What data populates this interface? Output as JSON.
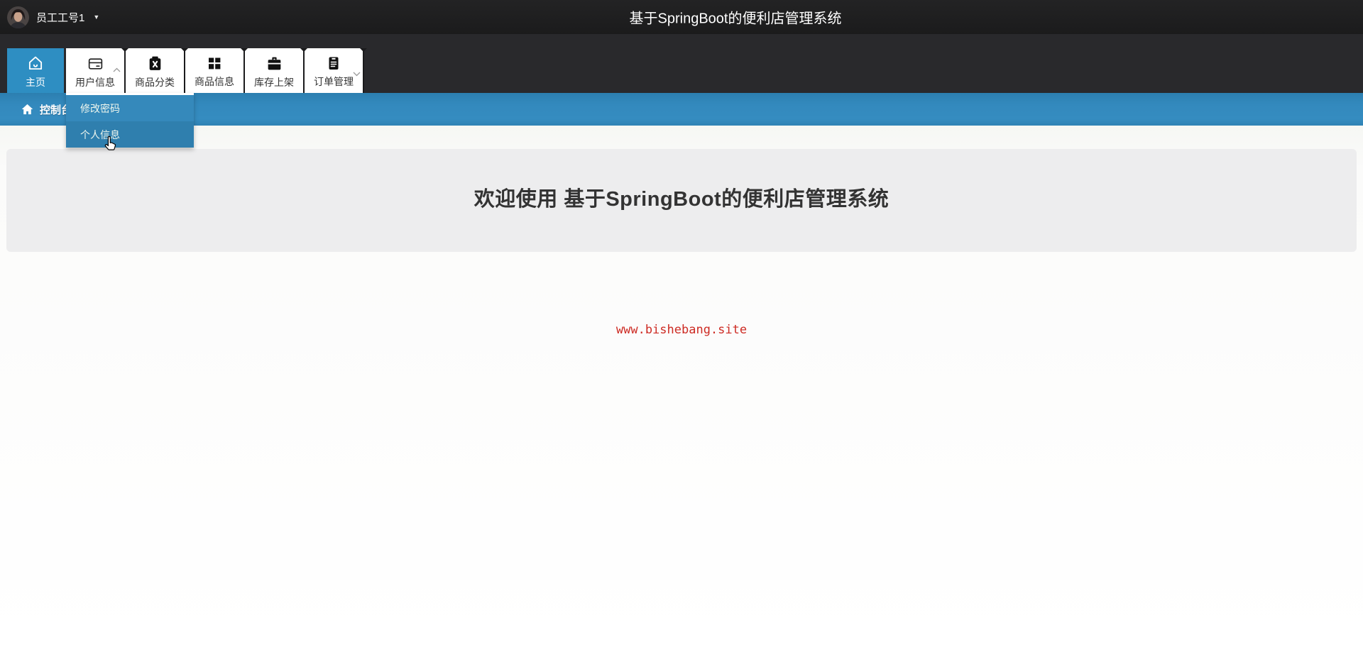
{
  "topbar": {
    "user_name": "员工工号1",
    "user_caret": "▼",
    "title": "基于SpringBoot的便利店管理系统"
  },
  "nav": {
    "tabs": [
      {
        "label": "主页",
        "icon": "home-icon",
        "active": true
      },
      {
        "label": "用户信息",
        "icon": "id-card-icon",
        "expanded": true
      },
      {
        "label": "商品分类",
        "icon": "category-box-icon"
      },
      {
        "label": "商品信息",
        "icon": "grid-icon"
      },
      {
        "label": "库存上架",
        "icon": "briefcase-icon"
      },
      {
        "label": "订单管理",
        "icon": "clipboard-icon",
        "collapsed": true
      }
    ]
  },
  "breadcrumb": {
    "label": "控制台",
    "icon": "home-icon"
  },
  "dropdown": {
    "items": [
      {
        "label": "修改密码"
      },
      {
        "label": "个人信息",
        "hovered": true
      }
    ]
  },
  "main": {
    "welcome_heading": "欢迎使用 基于SpringBoot的便利店管理系统",
    "site_link": "www.bishebang.site"
  },
  "colors": {
    "topbar_bg": "#1e1e1f",
    "navstrip_bg": "#29292c",
    "active_tab_blue": "#2e8ec2",
    "breadcrumb_blue": "#3389bd",
    "dropdown_blue": "#3589bb",
    "dropdown_hover_blue": "#2f7fae",
    "jumbotron_bg": "#ededee",
    "heading_text": "#333333",
    "link_red": "#cd2b24"
  }
}
